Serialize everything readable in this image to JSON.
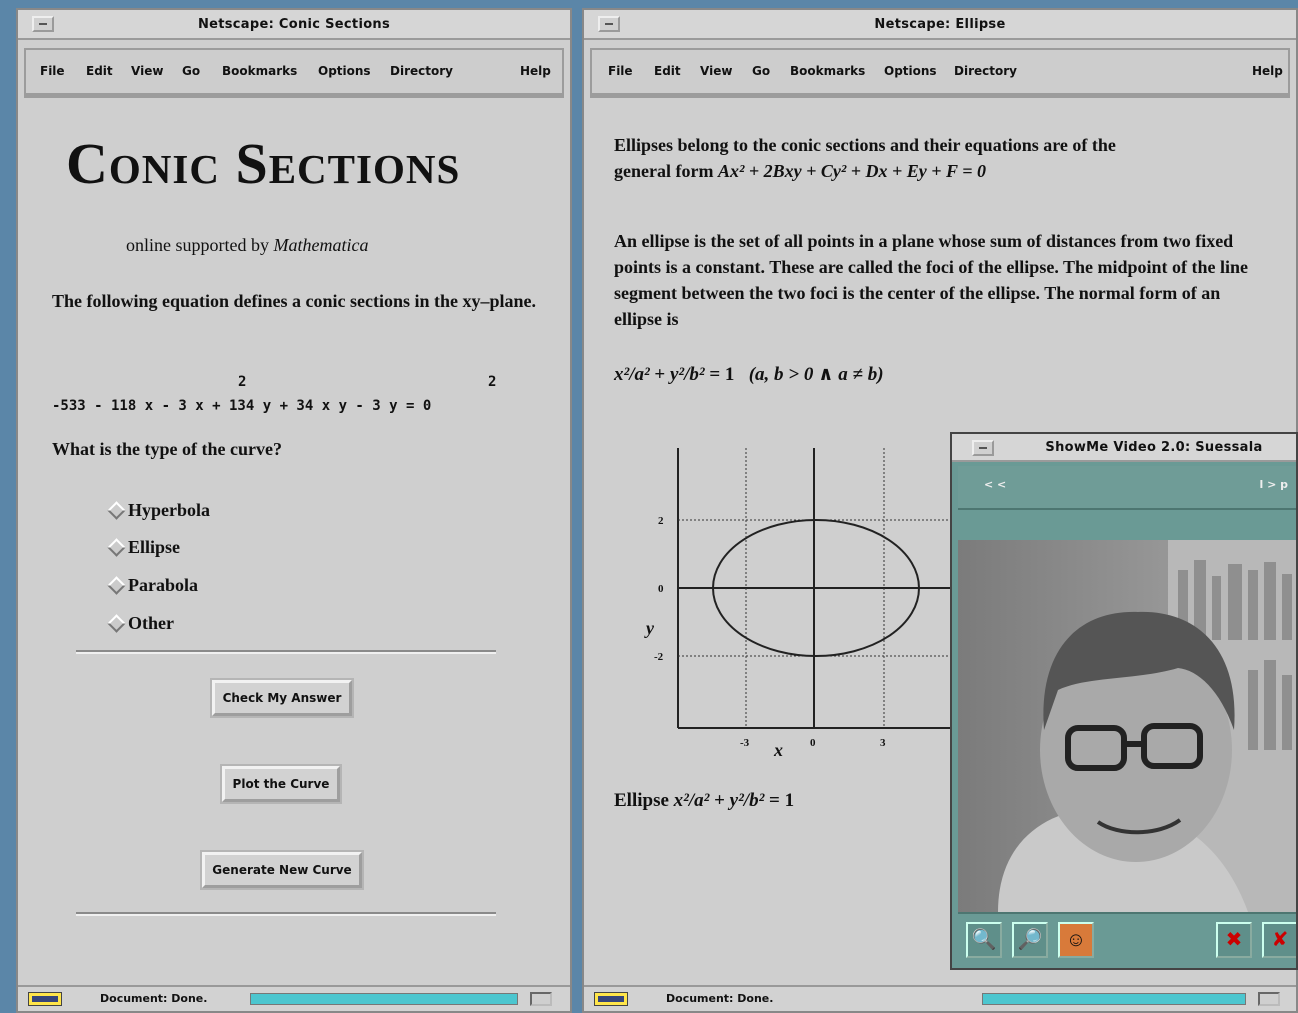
{
  "left_window": {
    "title": "Netscape: Conic Sections",
    "menu": [
      "File",
      "Edit",
      "View",
      "Go",
      "Bookmarks",
      "Options",
      "Directory",
      "Help"
    ],
    "heading": "Conic Sections",
    "subtitle_prefix": "online supported by ",
    "subtitle_em": "Mathematica",
    "intro": "The following equation defines a conic sections in the xy–plane.",
    "equation_exponent": "2",
    "equation_exponent2": "2",
    "equation": "-533 - 118 x - 3 x",
    "equation_mid": " + 134 y + 34 x y - 3 y",
    "equation_end": " = 0",
    "question": "What is the type of the curve?",
    "options": [
      "Hyperbola",
      "Ellipse",
      "Parabola",
      "Other"
    ],
    "buttons": {
      "check": "Check My Answer",
      "plot": "Plot the Curve",
      "generate": "Generate New Curve"
    },
    "status": "Document: Done."
  },
  "right_window": {
    "title": "Netscape: Ellipse",
    "menu": [
      "File",
      "Edit",
      "View",
      "Go",
      "Bookmarks",
      "Options",
      "Directory",
      "Help"
    ],
    "para1_line1": "Ellipses belong to the conic sections and their equations are of the",
    "para1_line2_prefix": "general form ",
    "para1_formula": "Ax² + 2Bxy + Cy² + Dx + Ey + F = 0",
    "para2": "An ellipse is the set of all points in a plane whose sum of distances from two fixed points is a constant. These are called the foci of the ellipse. The midpoint of the line segment between the two foci is the center of the ellipse. The normal form of an ellipse is",
    "normal_form_fracs": [
      "x²/a²",
      "y²/b²"
    ],
    "normal_form_rhs": "= 1",
    "normal_form_cond": "(a, b > 0 ∧ a ≠ b)",
    "caption_prefix": "Ellipse",
    "caption_rhs": "= 1",
    "status": "Document: Done."
  },
  "plot": {
    "y_ticks": [
      "2",
      "0",
      "-2"
    ],
    "x_ticks": [
      "-3",
      "0",
      "3"
    ],
    "xlabel": "x",
    "ylabel": "y"
  },
  "video_window": {
    "title": "ShowMe Video 2.0: Suessala",
    "toolbar_left": "< <",
    "toolbar_right": "l > p"
  },
  "colors": {
    "window_bg": "#cfcfcf",
    "desktop": "#5b86a8",
    "progress": "#4cc6cf",
    "video_chrome": "#6a9a95"
  }
}
